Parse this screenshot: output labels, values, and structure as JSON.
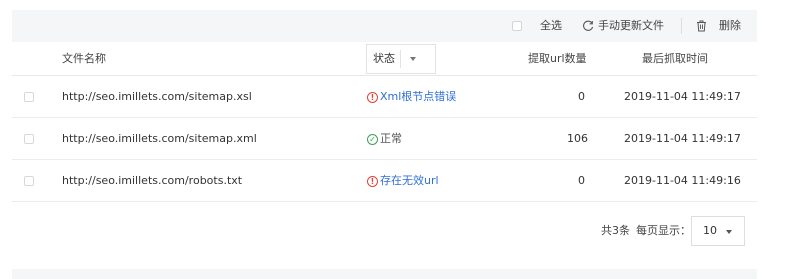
{
  "toolbar": {
    "select_all_label": "全选",
    "refresh_label": "手动更新文件",
    "delete_label": "删除",
    "refresh_icon": "refresh-icon",
    "delete_icon": "trash-icon"
  },
  "table": {
    "columns": {
      "file_name": "文件名称",
      "status": "状态",
      "url_count": "提取url数量",
      "last_fetch": "最后抓取时间"
    },
    "rows": [
      {
        "url": "http://seo.imillets.com/sitemap.xsl",
        "status": "Xml根节点错误",
        "status_type": "error",
        "count": "0",
        "time": "2019-11-04 11:49:17"
      },
      {
        "url": "http://seo.imillets.com/sitemap.xml",
        "status": "正常",
        "status_type": "ok",
        "count": "106",
        "time": "2019-11-04 11:49:17"
      },
      {
        "url": "http://seo.imillets.com/robots.txt",
        "status": "存在无效url",
        "status_type": "error",
        "count": "0",
        "time": "2019-11-04 11:49:16"
      }
    ]
  },
  "pagination": {
    "total": "共3条",
    "per_page_label": "每页显示：",
    "page_size": "10"
  },
  "colors": {
    "link_blue": "#2f6fd6",
    "error_red": "#e0413b",
    "ok_green": "#3aa35a",
    "toolbar_bg": "#f5f6f7"
  }
}
